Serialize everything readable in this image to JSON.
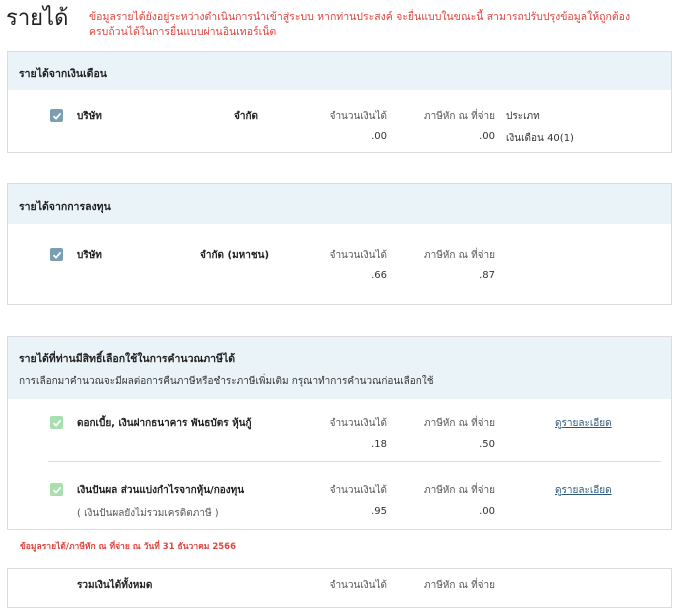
{
  "page": {
    "title": "รายได้",
    "warning": "ข้อมูลรายได้ยังอยู่ระหว่างดำเนินการนำเข้าสู่ระบบ หากท่านประสงค์ จะยื่นแบบในขณะนี้ สามารถปรับปรุงข้อมูลให้ถูกต้องครบถ้วนได้ในการยื่นแบบผ่านอินเทอร์เน็ต"
  },
  "salary": {
    "heading": "รายได้จากเงินเดือน",
    "company_prefix": "บริษัท",
    "company_suffix": "จำกัด",
    "amount_label": "จำนวนเงินได้",
    "amount": ".00",
    "tax_label": "ภาษีหัก ณ ที่จ่าย",
    "tax": ".00",
    "type_label": "ประเภท",
    "type": "เงินเดือน 40(1)"
  },
  "investment": {
    "heading": "รายได้จากการลงทุน",
    "company_prefix": "บริษัท",
    "company_suffix": "จำกัด (มหาชน)",
    "amount_label": "จำนวนเงินได้",
    "amount": ".66",
    "tax_label": "ภาษีหัก ณ ที่จ่าย",
    "tax": ".87"
  },
  "optional": {
    "heading": "รายได้ที่ท่านมีสิทธิ์เลือกใช้ในการคำนวณภาษีได้",
    "subheading": "การเลือกมาคำนวณจะมีผลต่อการคืนภาษีหรือชำระภาษีเพิ่มเติม กรุณาทำการคำนวณก่อนเลือกใช้",
    "items": [
      {
        "label": "ดอกเบี้ย, เงินฝากธนาคาร พันธบัตร หุ้นกู้",
        "note": "",
        "amount_label": "จำนวนเงินได้",
        "amount": ".18",
        "tax_label": "ภาษีหัก ณ ที่จ่าย",
        "tax": ".50",
        "link": "ดูรายละเอียด"
      },
      {
        "label": "เงินปันผล ส่วนแบ่งกำไรจากหุ้น/กองทุน",
        "note": "( เงินปันผลยังไม่รวมเครดิตภาษี )",
        "amount_label": "จำนวนเงินได้",
        "amount": ".95",
        "tax_label": "ภาษีหัก ณ ที่จ่าย",
        "tax": ".00",
        "link": "ดูรายละเอียด"
      }
    ]
  },
  "footnote": "ข้อมูลรายได้/ภาษีหัก ณ ที่จ่าย ณ วันที่ 31 ธันวาคม 2566",
  "total": {
    "label": "รวมเงินได้ทั้งหมด",
    "amount_label": "จำนวนเงินได้",
    "tax_label": "ภาษีหัก ณ ที่จ่าย"
  },
  "colors": {
    "warning": "#e0443e",
    "header_bg": "#eaf4f8",
    "checkbox_gray": "#7a9eb2",
    "checkbox_green": "#a8dfae",
    "link": "#2d5a7a"
  },
  "icons": {
    "checkbox": "check-icon"
  }
}
